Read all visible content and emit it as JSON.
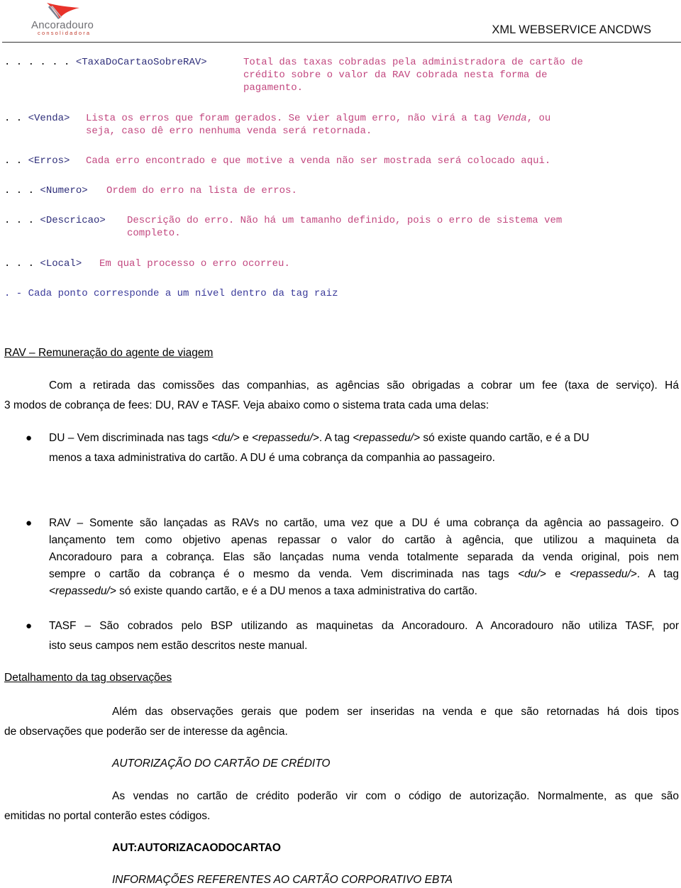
{
  "header": {
    "logo_name": "Ancoradouro",
    "logo_sub": "consolidadora",
    "title": "XML WEBSERVICE ANCDWS"
  },
  "xml_fields": [
    {
      "dots": ". . . . . .",
      "tag": "<TaxaDoCartaoSobreRAV>",
      "desc_lines": [
        "Total das taxas cobradas pela administradora de cartão de",
        "crédito sobre o valor da RAV cobrada nesta forma de",
        "pagamento."
      ]
    },
    {
      "dots": ". .",
      "tag": "<Venda>",
      "desc_lines": [
        "Lista os erros que foram gerados. Se vier algum erro, não virá a tag ",
        "seja, caso dê erro nenhuma venda será retornada."
      ],
      "desc_italic_word": "Venda",
      "desc_after_italic": ", ou"
    },
    {
      "dots": ". .",
      "tag": "<Erros>",
      "desc_lines": [
        "Cada erro encontrado e que motive a venda não ser mostrada será colocado aqui."
      ]
    },
    {
      "dots": ". . .",
      "tag": "<Numero>",
      "desc_lines": [
        "Ordem do erro na lista de erros."
      ]
    },
    {
      "dots": ". . .",
      "tag": "<Descricao>",
      "desc_lines": [
        "Descrição do erro. Não há um tamanho definido, pois o erro de sistema vem",
        "completo."
      ]
    },
    {
      "dots": ". . .",
      "tag": "<Local>",
      "desc_lines": [
        "Em qual processo o erro ocorreu."
      ]
    }
  ],
  "legend_note": ". - Cada ponto corresponde a um nível dentro da tag raiz",
  "rav_section": {
    "heading": "RAV – Remuneração do agente de viagem",
    "intro_lines": [
      "Com a retirada das comissões das companhias, as agências são obrigadas a cobrar um fee (taxa de serviço). Há",
      "3 modos de cobrança de fees: DU, RAV e TASF. Veja abaixo como o sistema trata cada uma delas:"
    ],
    "bullets": [
      {
        "lines": [
          [
            "DU – Vem discriminada nas tags ",
            "<du/>",
            " e ",
            "<repassedu/>",
            ". A tag ",
            "<repassedu/>",
            " só existe quando cartão, e é a DU"
          ],
          [
            "menos a taxa administrativa do cartão. A DU é uma cobrança da companhia ao passageiro."
          ]
        ]
      },
      {
        "lines": [
          [
            "RAV – Somente são lançadas as RAVs no cartão, uma vez que a DU é uma cobrança da agência ao passageiro. O"
          ],
          [
            "lançamento tem como objetivo apenas repassar o valor do cartão à agência, que utilizou a maquineta da"
          ],
          [
            "Ancoradouro para a cobrança. Elas são lançadas numa venda totalmente separada da venda original, pois nem"
          ],
          [
            "sempre o cartão da cobrança é o mesmo da venda. Vem discriminada nas tags ",
            "<du/>",
            " e ",
            "<repassedu/>",
            ". A tag"
          ],
          [
            "<repassedu/>",
            " só existe quando cartão, e é a DU menos a taxa administrativa do cartão."
          ]
        ]
      },
      {
        "lines": [
          [
            "TASF – São cobrados pelo BSP utilizando as maquinetas da Ancoradouro. A Ancoradouro não utiliza TASF, por"
          ],
          [
            "isto seus campos nem estão descritos neste manual."
          ]
        ]
      }
    ]
  },
  "obs_section": {
    "heading": "Detalhamento da tag observações",
    "intro_lines": [
      "Além das observações gerais que podem ser inseridas na venda e que são retornadas há dois tipos",
      "de observações que poderão ser de interesse da agência."
    ],
    "sub1_title": "AUTORIZAÇÃO DO CARTÃO DE CRÉDITO",
    "sub1_lines": [
      "As vendas no cartão de crédito poderão vir com o código de autorização. Normalmente, as que são",
      "emitidas no portal conterão estes códigos."
    ],
    "sub1_code": "AUT:AUTORIZACAODOCARTAO",
    "sub2_title": "INFORMAÇÕES REFERENTES AO CARTÃO CORPORATIVO EBTA"
  }
}
